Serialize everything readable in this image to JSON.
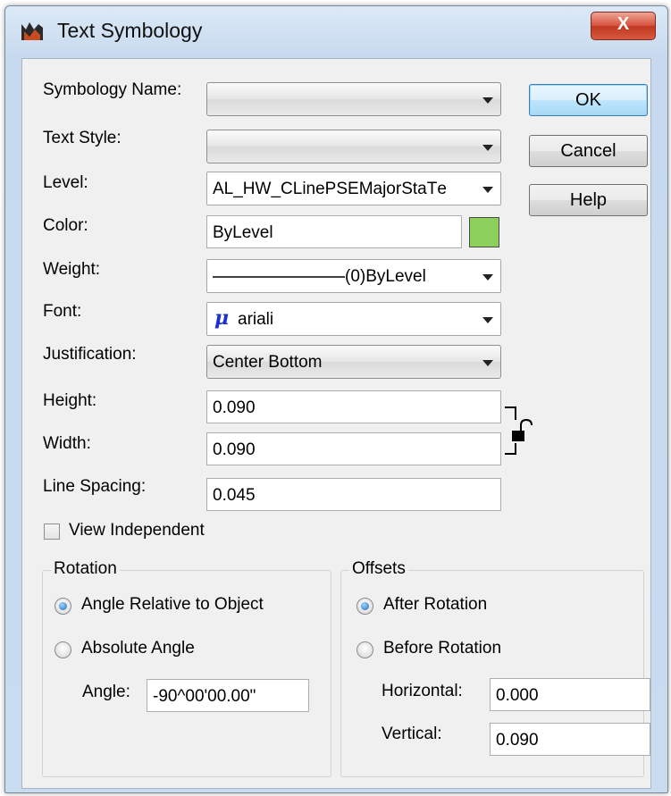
{
  "window": {
    "title": "Text Symbology",
    "close_label": "X"
  },
  "buttons": {
    "ok": "OK",
    "cancel": "Cancel",
    "help": "Help"
  },
  "form": {
    "symbology_name": {
      "label": "Symbology Name:",
      "value": ""
    },
    "text_style": {
      "label": "Text Style:",
      "value": ""
    },
    "level": {
      "label": "Level:",
      "value": "AL_HW_CLinePSEMajorStaTе"
    },
    "color": {
      "label": "Color:",
      "value": "ByLevel",
      "swatch": "#8ccf5a"
    },
    "weight": {
      "label": "Weight:",
      "value": "(0)ByLevel"
    },
    "font": {
      "label": "Font:",
      "value": "ariali",
      "icon": "font-mu-icon"
    },
    "justification": {
      "label": "Justification:",
      "value": "Center Bottom"
    },
    "height": {
      "label": "Height:",
      "value": "0.090"
    },
    "width": {
      "label": "Width:",
      "value": "0.090"
    },
    "line_spacing": {
      "label": "Line Spacing:",
      "value": "0.045"
    },
    "view_independent": {
      "label": "View Independent",
      "checked": false
    }
  },
  "rotation": {
    "title": "Rotation",
    "relative_label": "Angle Relative to Object",
    "absolute_label": "Absolute Angle",
    "selected": "relative",
    "angle_label": "Angle:",
    "angle_value": "-90^00'00.00\""
  },
  "offsets": {
    "title": "Offsets",
    "after_label": "After Rotation",
    "before_label": "Before Rotation",
    "selected": "after",
    "horizontal_label": "Horizontal:",
    "horizontal_value": "0.000",
    "vertical_label": "Vertical:",
    "vertical_value": "0.090"
  }
}
